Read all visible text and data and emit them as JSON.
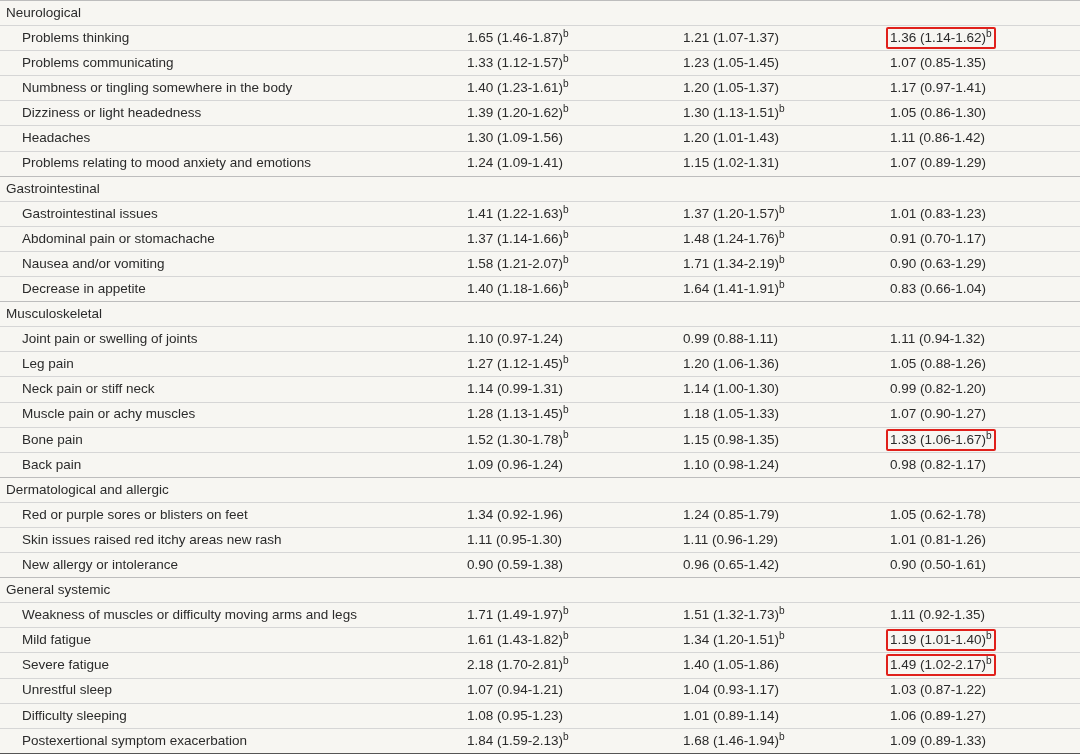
{
  "sections": [
    {
      "title": "Neurological",
      "rows": [
        {
          "label": "Problems thinking",
          "cells": [
            "1.65 (1.46-1.87)$^{b}$",
            "1.21 (1.07-1.37)",
            "1.36 (1.14-1.62)$^{b}$"
          ],
          "boxed": true
        },
        {
          "label": "Problems communicating",
          "cells": [
            "1.33 (1.12-1.57)$^{b}$",
            "1.23 (1.05-1.45)",
            "1.07 (0.85-1.35)"
          ],
          "boxed": false
        },
        {
          "label": "Numbness or tingling somewhere in the body",
          "cells": [
            "1.40 (1.23-1.61)$^{b}$",
            "1.20 (1.05-1.37)",
            "1.17 (0.97-1.41)"
          ],
          "boxed": false
        },
        {
          "label": "Dizziness or light headedness",
          "cells": [
            "1.39 (1.20-1.62)$^{b}$",
            "1.30 (1.13-1.51)$^{b}$",
            "1.05 (0.86-1.30)"
          ],
          "boxed": false
        },
        {
          "label": "Headaches",
          "cells": [
            "1.30 (1.09-1.56)",
            "1.20 (1.01-1.43)",
            "1.11 (0.86-1.42)"
          ],
          "boxed": false
        },
        {
          "label": "Problems relating to mood anxiety and emotions",
          "cells": [
            "1.24 (1.09-1.41)",
            "1.15 (1.02-1.31)",
            "1.07 (0.89-1.29)"
          ],
          "boxed": false
        }
      ]
    },
    {
      "title": "Gastrointestinal",
      "rows": [
        {
          "label": "Gastrointestinal issues",
          "cells": [
            "1.41 (1.22-1.63)$^{b}$",
            "1.37 (1.20-1.57)$^{b}$",
            "1.01 (0.83-1.23)"
          ],
          "boxed": false
        },
        {
          "label": "Abdominal pain or stomachache",
          "cells": [
            "1.37 (1.14-1.66)$^{b}$",
            "1.48 (1.24-1.76)$^{b}$",
            "0.91 (0.70-1.17)"
          ],
          "boxed": false
        },
        {
          "label": "Nausea and/or vomiting",
          "cells": [
            "1.58 (1.21-2.07)$^{b}$",
            "1.71 (1.34-2.19)$^{b}$",
            "0.90 (0.63-1.29)"
          ],
          "boxed": false
        },
        {
          "label": "Decrease in appetite",
          "cells": [
            "1.40 (1.18-1.66)$^{b}$",
            "1.64 (1.41-1.91)$^{b}$",
            "0.83 (0.66-1.04)"
          ],
          "boxed": false
        }
      ]
    },
    {
      "title": "Musculoskeletal",
      "rows": [
        {
          "label": "Joint pain or swelling of joints",
          "cells": [
            "1.10 (0.97-1.24)",
            "0.99 (0.88-1.11)",
            "1.11 (0.94-1.32)"
          ],
          "boxed": false
        },
        {
          "label": "Leg pain",
          "cells": [
            "1.27 (1.12-1.45)$^{b}$",
            "1.20 (1.06-1.36)",
            "1.05 (0.88-1.26)"
          ],
          "boxed": false
        },
        {
          "label": "Neck pain or stiff neck",
          "cells": [
            "1.14 (0.99-1.31)",
            "1.14 (1.00-1.30)",
            "0.99 (0.82-1.20)"
          ],
          "boxed": false
        },
        {
          "label": "Muscle pain or achy muscles",
          "cells": [
            "1.28 (1.13-1.45)$^{b}$",
            "1.18 (1.05-1.33)",
            "1.07 (0.90-1.27)"
          ],
          "boxed": false
        },
        {
          "label": "Bone pain",
          "cells": [
            "1.52 (1.30-1.78)$^{b}$",
            "1.15 (0.98-1.35)",
            "1.33 (1.06-1.67)$^{b}$"
          ],
          "boxed": true
        },
        {
          "label": "Back pain",
          "cells": [
            "1.09 (0.96-1.24)",
            "1.10 (0.98-1.24)",
            "0.98 (0.82-1.17)"
          ],
          "boxed": false
        }
      ]
    },
    {
      "title": "Dermatological and allergic",
      "rows": [
        {
          "label": "Red or purple sores or blisters on feet",
          "cells": [
            "1.34 (0.92-1.96)",
            "1.24 (0.85-1.79)",
            "1.05 (0.62-1.78)"
          ],
          "boxed": false
        },
        {
          "label": "Skin issues raised red itchy areas new rash",
          "cells": [
            "1.11 (0.95-1.30)",
            "1.11 (0.96-1.29)",
            "1.01 (0.81-1.26)"
          ],
          "boxed": false
        },
        {
          "label": "New allergy or intolerance",
          "cells": [
            "0.90 (0.59-1.38)",
            "0.96 (0.65-1.42)",
            "0.90 (0.50-1.61)"
          ],
          "boxed": false
        }
      ]
    },
    {
      "title": "General systemic",
      "rows": [
        {
          "label": "Weakness of muscles or difficulty moving arms and legs",
          "cells": [
            "1.71 (1.49-1.97)$^{b}$",
            "1.51 (1.32-1.73)$^{b}$",
            "1.11 (0.92-1.35)"
          ],
          "boxed": false
        },
        {
          "label": "Mild fatigue",
          "cells": [
            "1.61 (1.43-1.82)$^{b}$",
            "1.34 (1.20-1.51)$^{b}$",
            "1.19 (1.01-1.40)$^{b}$"
          ],
          "boxed": true
        },
        {
          "label": "Severe fatigue",
          "cells": [
            "2.18 (1.70-2.81)$^{b}$",
            "1.40 (1.05-1.86)",
            "1.49 (1.02-2.17)$^{b}$"
          ],
          "boxed": true
        },
        {
          "label": "Unrestful sleep",
          "cells": [
            "1.07 (0.94-1.21)",
            "1.04 (0.93-1.17)",
            "1.03 (0.87-1.22)"
          ],
          "boxed": false
        },
        {
          "label": "Difficulty sleeping",
          "cells": [
            "1.08 (0.95-1.23)",
            "1.01 (0.89-1.14)",
            "1.06 (0.89-1.27)"
          ],
          "boxed": false
        },
        {
          "label": "Postexertional symptom exacerbation",
          "cells": [
            "1.84 (1.59-2.13)$^{b}$",
            "1.68 (1.46-1.94)$^{b}$",
            "1.09 (0.89-1.33)"
          ],
          "boxed": false
        }
      ]
    }
  ]
}
